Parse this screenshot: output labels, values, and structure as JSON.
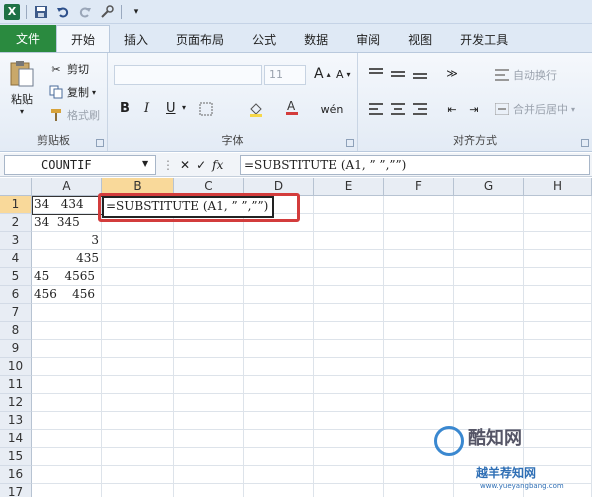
{
  "tabs": {
    "file": "文件",
    "items": [
      "开始",
      "插入",
      "页面布局",
      "公式",
      "数据",
      "审阅",
      "视图",
      "开发工具"
    ]
  },
  "ribbon": {
    "clipboard": {
      "label": "剪贴板",
      "paste": "粘贴",
      "cut": "剪切",
      "copy": "复制",
      "format_painter": "格式刷"
    },
    "font": {
      "label": "字体",
      "size": "11",
      "bold": "B",
      "italic": "I",
      "underline": "U",
      "grow": "A",
      "shrink": "A"
    },
    "alignment": {
      "label": "对齐方式",
      "wrap": "自动换行",
      "merge": "合并后居中"
    }
  },
  "formula_bar": {
    "name_box": "COUNTIF",
    "fx": "fx",
    "formula": "=SUBSTITUTE (A1, ” ”,””)"
  },
  "columns": [
    "A",
    "B",
    "C",
    "D",
    "E",
    "F",
    "G",
    "H"
  ],
  "rows": [
    "1",
    "2",
    "3",
    "4",
    "5",
    "6",
    "7",
    "8",
    "9",
    "10",
    "11",
    "12",
    "13",
    "14",
    "15",
    "16",
    "17"
  ],
  "cells": {
    "A1": "34   434",
    "A2": "34  345",
    "A3": "3",
    "A4": "435",
    "A5": "45    4565",
    "A6": "456    456"
  },
  "active_cell_formula": "=SUBSTITUTE (A1, ” ”,””)",
  "watermark": {
    "title": "酷知网",
    "sub": "越羊荐知网",
    "url": "www.yueyangbang.com"
  }
}
